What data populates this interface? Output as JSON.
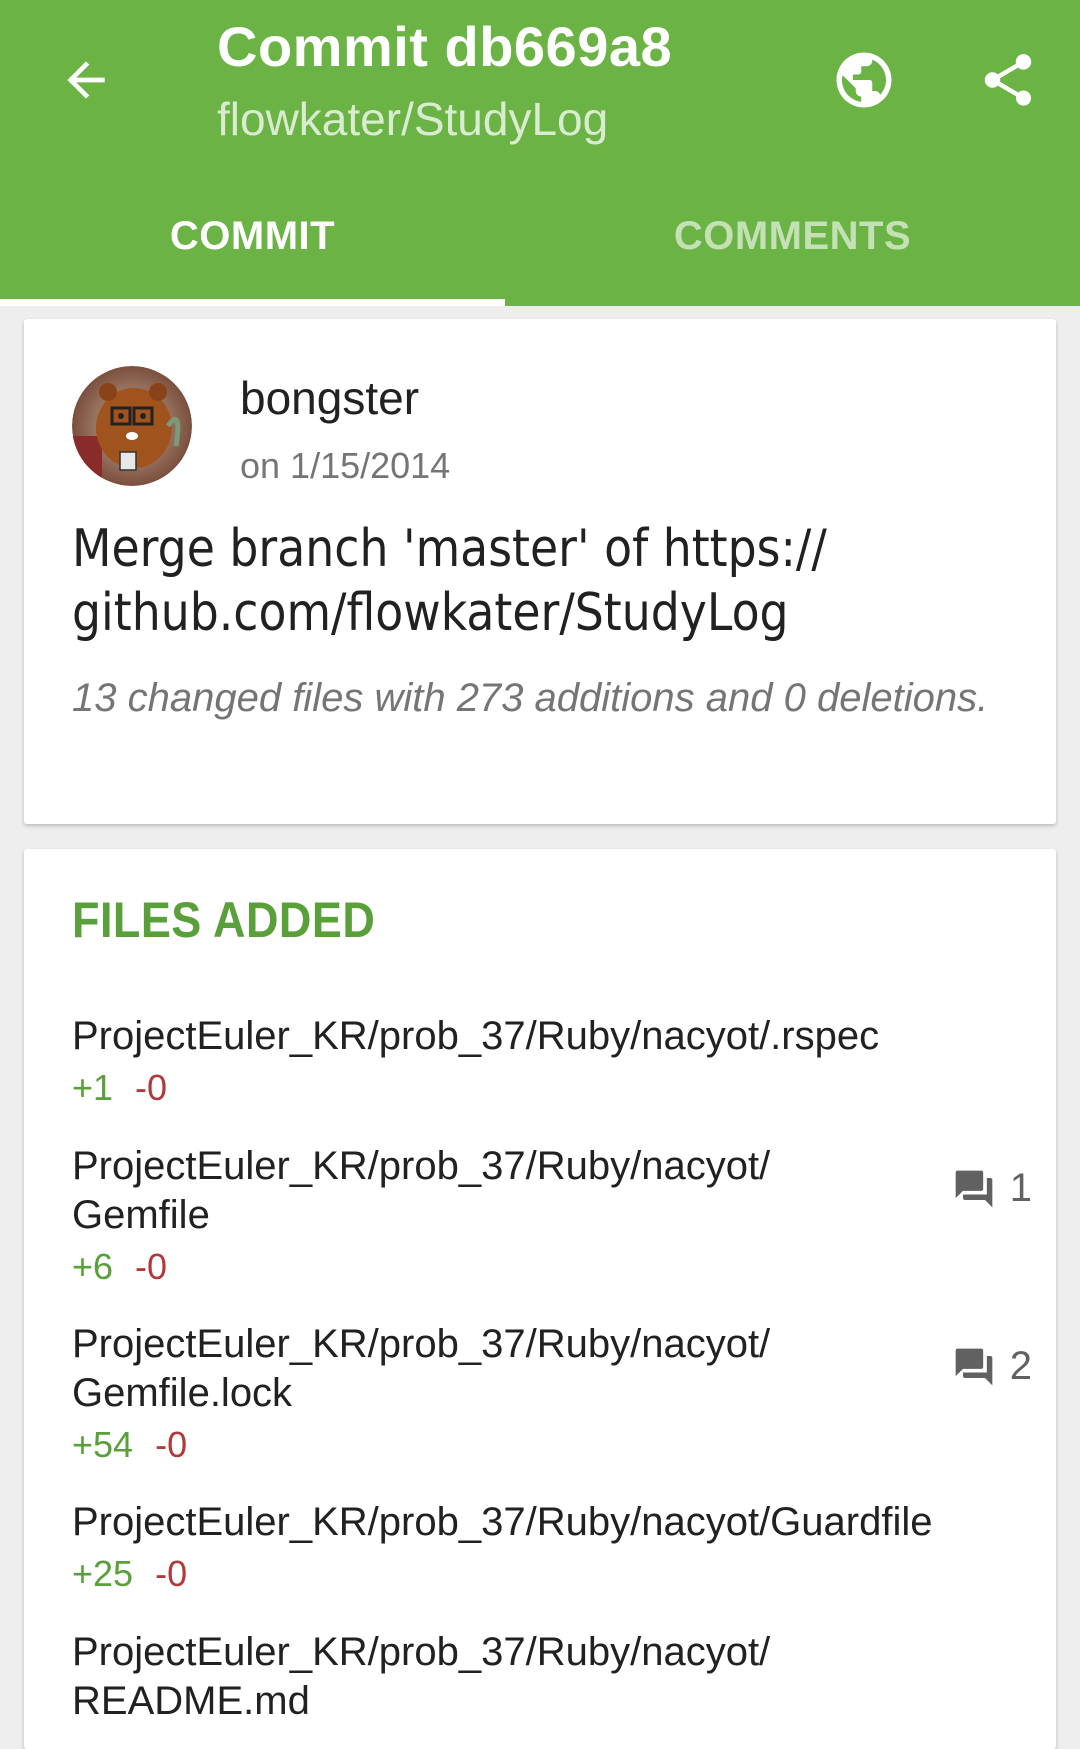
{
  "header": {
    "title": "Commit db669a8",
    "subtitle": "flowkater/StudyLog",
    "tabs": [
      "COMMIT",
      "COMMENTS"
    ],
    "bg_color": "#6ab344"
  },
  "commit": {
    "author": "bongster",
    "date": "on 1/15/2014",
    "message": "Merge branch 'master' of https://\ngithub.com/flowkater/StudyLog",
    "stats": "13 changed files with 273 additions and 0 deletions."
  },
  "files_section": {
    "title": "FILES ADDED",
    "files": [
      {
        "path": "ProjectEuler_KR/prob_37/Ruby/nacyot/.rspec",
        "additions": "+1",
        "deletions": "-0",
        "comments": ""
      },
      {
        "path": "ProjectEuler_KR/prob_37/Ruby/nacyot/ Gemfile",
        "additions": "+6",
        "deletions": "-0",
        "comments": "1"
      },
      {
        "path": "ProjectEuler_KR/prob_37/Ruby/nacyot/ Gemfile.lock",
        "additions": "+54",
        "deletions": "-0",
        "comments": "2"
      },
      {
        "path": "ProjectEuler_KR/prob_37/Ruby/nacyot/Guardfile",
        "additions": "+25",
        "deletions": "-0",
        "comments": ""
      },
      {
        "path": "ProjectEuler_KR/prob_37/Ruby/nacyot/ README.md",
        "additions": "",
        "deletions": "",
        "comments": ""
      }
    ]
  },
  "icons": {
    "back": "arrow-back-icon",
    "globe": "globe-icon",
    "share": "share-icon",
    "comment": "forum-icon"
  }
}
